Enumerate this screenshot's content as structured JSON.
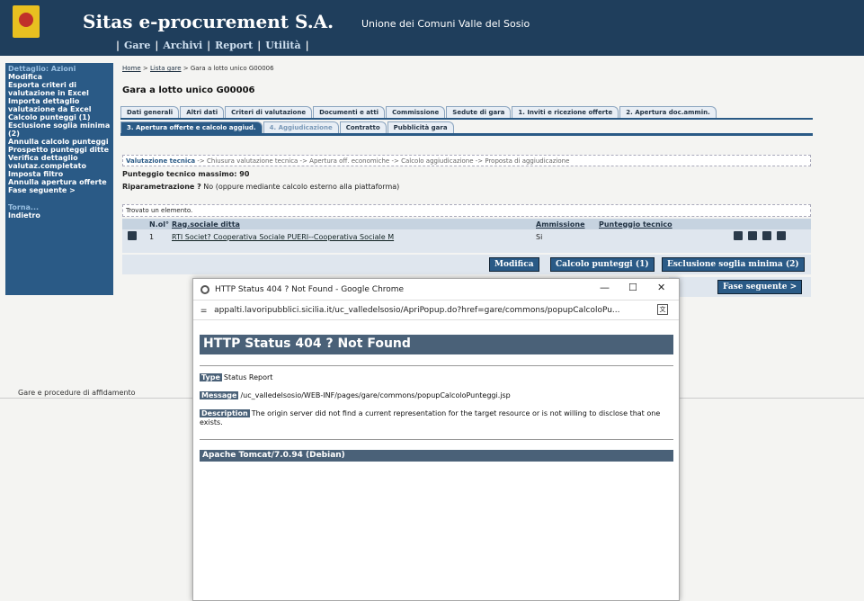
{
  "header": {
    "company": "Sitas e-procurement S.A.",
    "union": "Unione dei Comuni Valle del Sosio",
    "nav": [
      "Gare",
      "Archivi",
      "Report",
      "Utilità"
    ]
  },
  "sidebar": {
    "section_actions": "Dettaglio: Azioni",
    "items": [
      "Modifica",
      "Esporta criteri di valutazione in Excel",
      "Importa dettaglio valutazione da Excel",
      "Calcolo punteggi (1)",
      "Esclusione soglia minima (2)",
      "Annulla calcolo punteggi",
      "Prospetto punteggi ditte",
      "Verifica dettaglio valutaz.completato",
      "Imposta filtro",
      "Annulla apertura offerte",
      "Fase seguente >"
    ],
    "section_back": "Torna...",
    "back_item": "Indietro"
  },
  "breadcrumb": {
    "home": "Home",
    "sep": " > ",
    "list": "Lista gare",
    "current": "Gara a lotto unico G00006"
  },
  "page_title": "Gara a lotto unico G00006",
  "tabs_row1": [
    "Dati generali",
    "Altri dati",
    "Criteri di valutazione",
    "Documenti e atti",
    "Commissione",
    "Sedute di gara",
    "1. Inviti e ricezione offerte",
    "2. Apertura doc.ammin."
  ],
  "tabs_row2": [
    "3. Apertura offerte e calcolo aggiud.",
    "4. Aggiudicazione",
    "Contratto",
    "Pubblicità gara"
  ],
  "steps": {
    "current": "Valutazione tecnica",
    "rest": " -> Chiusura valutazione tecnica -> Apertura off. economiche -> Calcolo aggiudicazione -> Proposta di aggiudicazione"
  },
  "info": {
    "max_score": "Punteggio tecnico massimo: 90",
    "reparam_label": "Riparametrazione ?",
    "reparam_value": " No (oppure mediante calcolo esterno alla piattaforma)"
  },
  "found_text": "Trovato un elemento.",
  "grid": {
    "headers": [
      "N.ol°",
      "Rag.sociale ditta",
      "Ammissione",
      "Punteggio tecnico"
    ],
    "rows": [
      {
        "n": "1",
        "ditta": "RTI Societ? Cooperativa Sociale PUERI--Cooperativa Sociale M",
        "ammissione": "Si",
        "punteggio": ""
      }
    ]
  },
  "buttons": {
    "modifica": "Modifica",
    "calcolo": "Calcolo punteggi (1)",
    "esclusione": "Esclusione soglia minima (2)",
    "fase": "Fase seguente >"
  },
  "footer": "Gare e procedure di affidamento",
  "popup": {
    "title": "HTTP Status 404 ? Not Found - Google Chrome",
    "url": "appalti.lavoripubblici.sicilia.it/uc_valledelsosio/ApriPopup.do?href=gare/commons/popupCalcoloPu...",
    "minimize": "—",
    "maximize": "☐",
    "close": "✕",
    "heading": "HTTP Status 404 ? Not Found",
    "type_label": "Type",
    "type_value": "Status Report",
    "message_label": "Message",
    "message_value": "/uc_valledelsosio/WEB-INF/pages/gare/commons/popupCalcoloPunteggi.jsp",
    "desc_label": "Description",
    "desc_value": "The origin server did not find a current representation for the target resource or is not willing to disclose that one exists.",
    "server": "Apache Tomcat/7.0.94 (Debian)"
  }
}
